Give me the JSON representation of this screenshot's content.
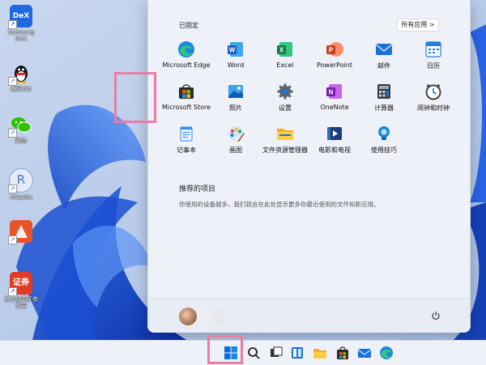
{
  "desktop": {
    "icons": [
      {
        "label": "Samsung DeX",
        "badge": "DeX"
      },
      {
        "label": "腾讯QQ"
      },
      {
        "label": "微信"
      },
      {
        "label": "RStudio",
        "badge": "R"
      },
      {
        "label": ""
      },
      {
        "label": "东方财富证券交易",
        "badge": "证券"
      }
    ]
  },
  "start_menu": {
    "pinned_title": "已固定",
    "all_apps_label": "所有应用  >",
    "apps": [
      {
        "label": "Microsoft Edge",
        "icon": "edge-icon"
      },
      {
        "label": "Word",
        "icon": "word-icon"
      },
      {
        "label": "Excel",
        "icon": "excel-icon"
      },
      {
        "label": "PowerPoint",
        "icon": "powerpoint-icon"
      },
      {
        "label": "邮件",
        "icon": "mail-icon"
      },
      {
        "label": "日历",
        "icon": "calendar-icon"
      },
      {
        "label": "Microsoft Store",
        "icon": "store-icon"
      },
      {
        "label": "照片",
        "icon": "photos-icon"
      },
      {
        "label": "设置",
        "icon": "settings-icon"
      },
      {
        "label": "OneNote",
        "icon": "onenote-icon"
      },
      {
        "label": "计算器",
        "icon": "calculator-icon"
      },
      {
        "label": "闹钟和时钟",
        "icon": "clock-icon"
      },
      {
        "label": "记事本",
        "icon": "notepad-icon"
      },
      {
        "label": "画图",
        "icon": "paint-icon"
      },
      {
        "label": "文件资源管理器",
        "icon": "file-explorer-icon"
      },
      {
        "label": "电影和电视",
        "icon": "movies-icon"
      },
      {
        "label": "使用技巧",
        "icon": "tips-icon"
      }
    ],
    "recommended_title": "推荐的项目",
    "recommended_desc": "你使用的设备越多，我们就会在此处显示更多你最近使用的文件和新应用。"
  },
  "colors": {
    "highlight": "#e87fa3",
    "accent": "#0067c0"
  }
}
